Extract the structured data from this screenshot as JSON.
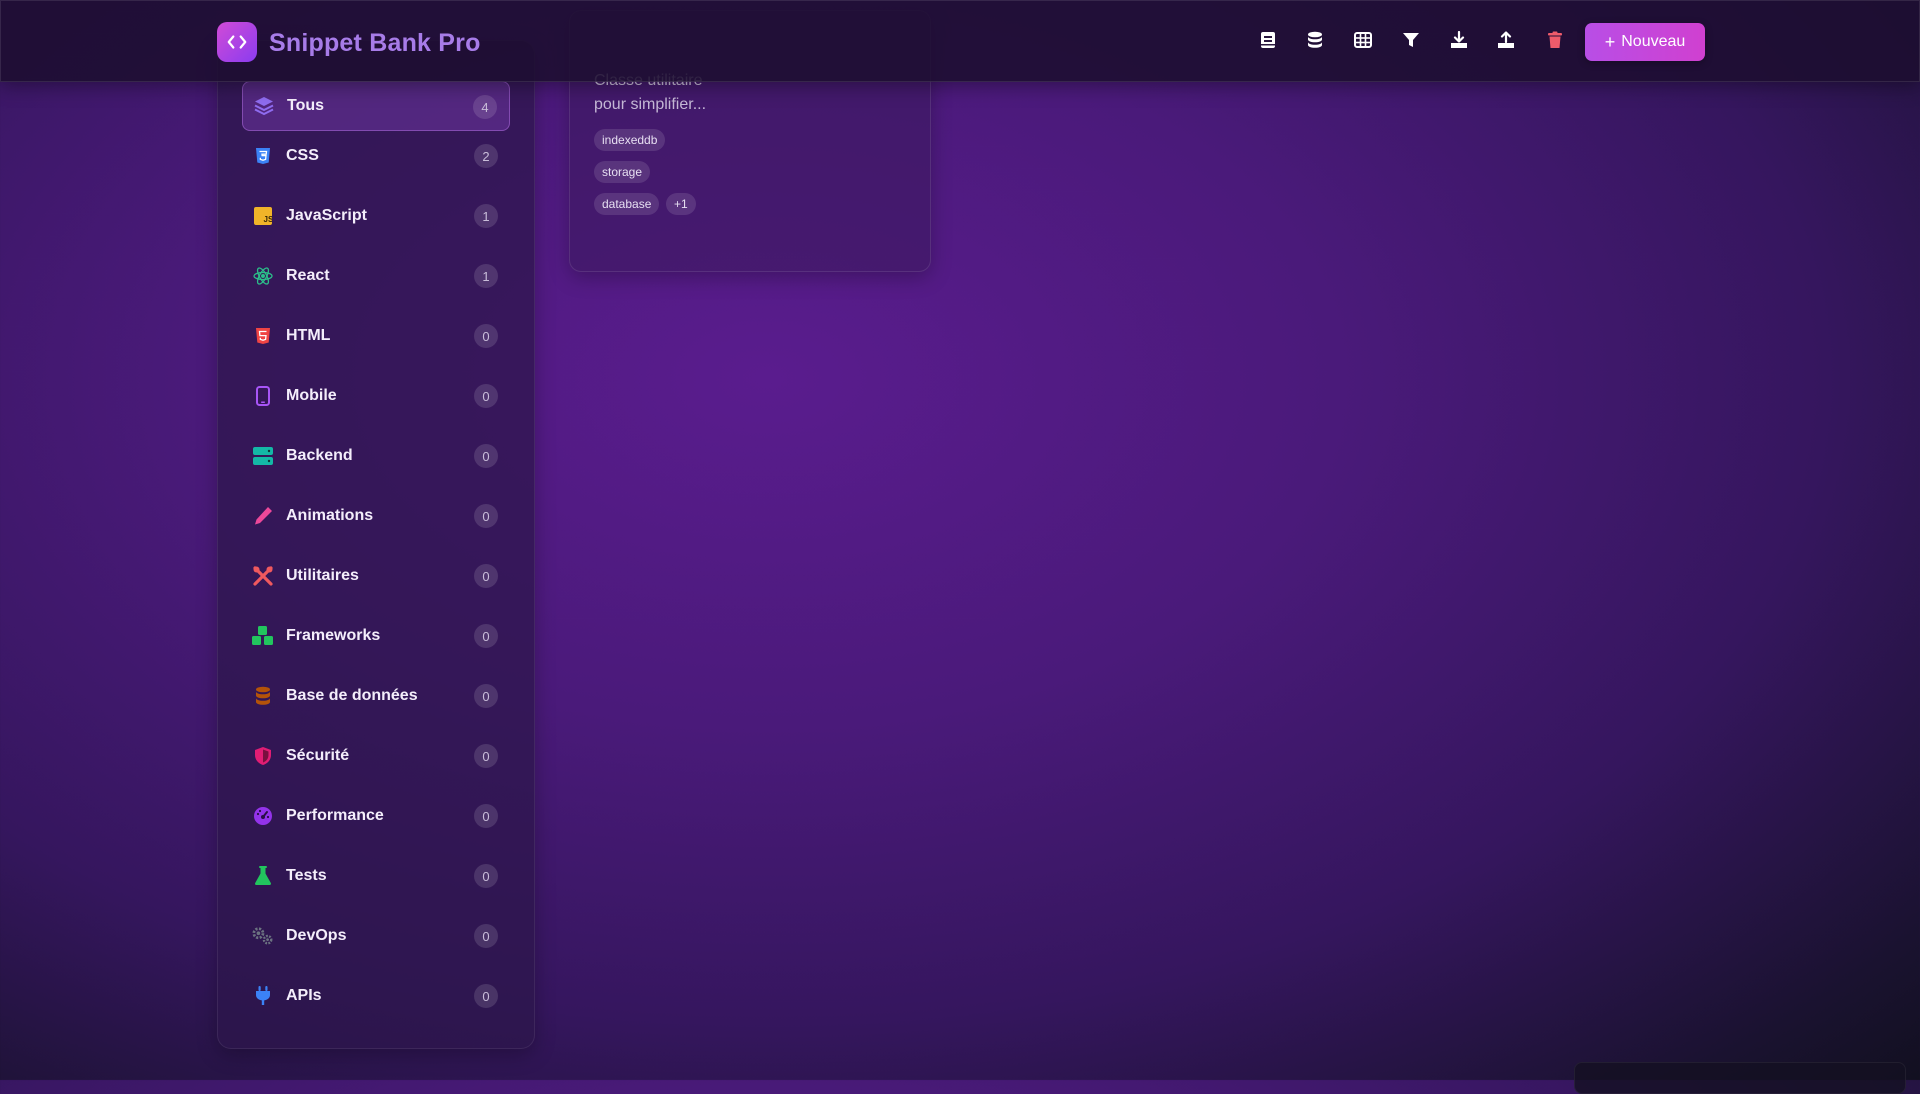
{
  "header": {
    "app_title": "Snippet Bank Pro",
    "logo_icon": "code-brackets-icon",
    "new_button_label": "Nouveau",
    "toolbar_icons": [
      "notes-icon",
      "database-icon",
      "table-icon",
      "filter-icon",
      "download-icon",
      "upload-icon",
      "trash-icon"
    ]
  },
  "sidebar": {
    "items": [
      {
        "label": "Tous",
        "count": "4",
        "icon": "layers-icon",
        "active": true
      },
      {
        "label": "CSS",
        "count": "2",
        "icon": "css3-icon"
      },
      {
        "label": "JavaScript",
        "count": "1",
        "icon": "javascript-icon"
      },
      {
        "label": "React",
        "count": "1",
        "icon": "react-icon"
      },
      {
        "label": "HTML",
        "count": "0",
        "icon": "html5-icon"
      },
      {
        "label": "Mobile",
        "count": "0",
        "icon": "mobile-icon"
      },
      {
        "label": "Backend",
        "count": "0",
        "icon": "server-icon"
      },
      {
        "label": "Animations",
        "count": "0",
        "icon": "pencil-icon"
      },
      {
        "label": "Utilitaires",
        "count": "0",
        "icon": "tools-icon"
      },
      {
        "label": "Frameworks",
        "count": "0",
        "icon": "cubes-icon"
      },
      {
        "label": "Base de données",
        "count": "0",
        "icon": "database-icon"
      },
      {
        "label": "Sécurité",
        "count": "0",
        "icon": "shield-icon"
      },
      {
        "label": "Performance",
        "count": "0",
        "icon": "gauge-icon"
      },
      {
        "label": "Tests",
        "count": "0",
        "icon": "flask-icon"
      },
      {
        "label": "DevOps",
        "count": "0",
        "icon": "gears-icon"
      },
      {
        "label": "APIs",
        "count": "0",
        "icon": "plug-icon"
      }
    ]
  },
  "card": {
    "description_line1": "Classe utilitaire",
    "description_line2": "pour simplifier...",
    "tags": [
      "indexeddb",
      "storage",
      "database",
      "+1"
    ]
  },
  "colors": {
    "accent": "#b84ee6",
    "title": "#a77ce8",
    "trash": "#ef5b6b"
  }
}
